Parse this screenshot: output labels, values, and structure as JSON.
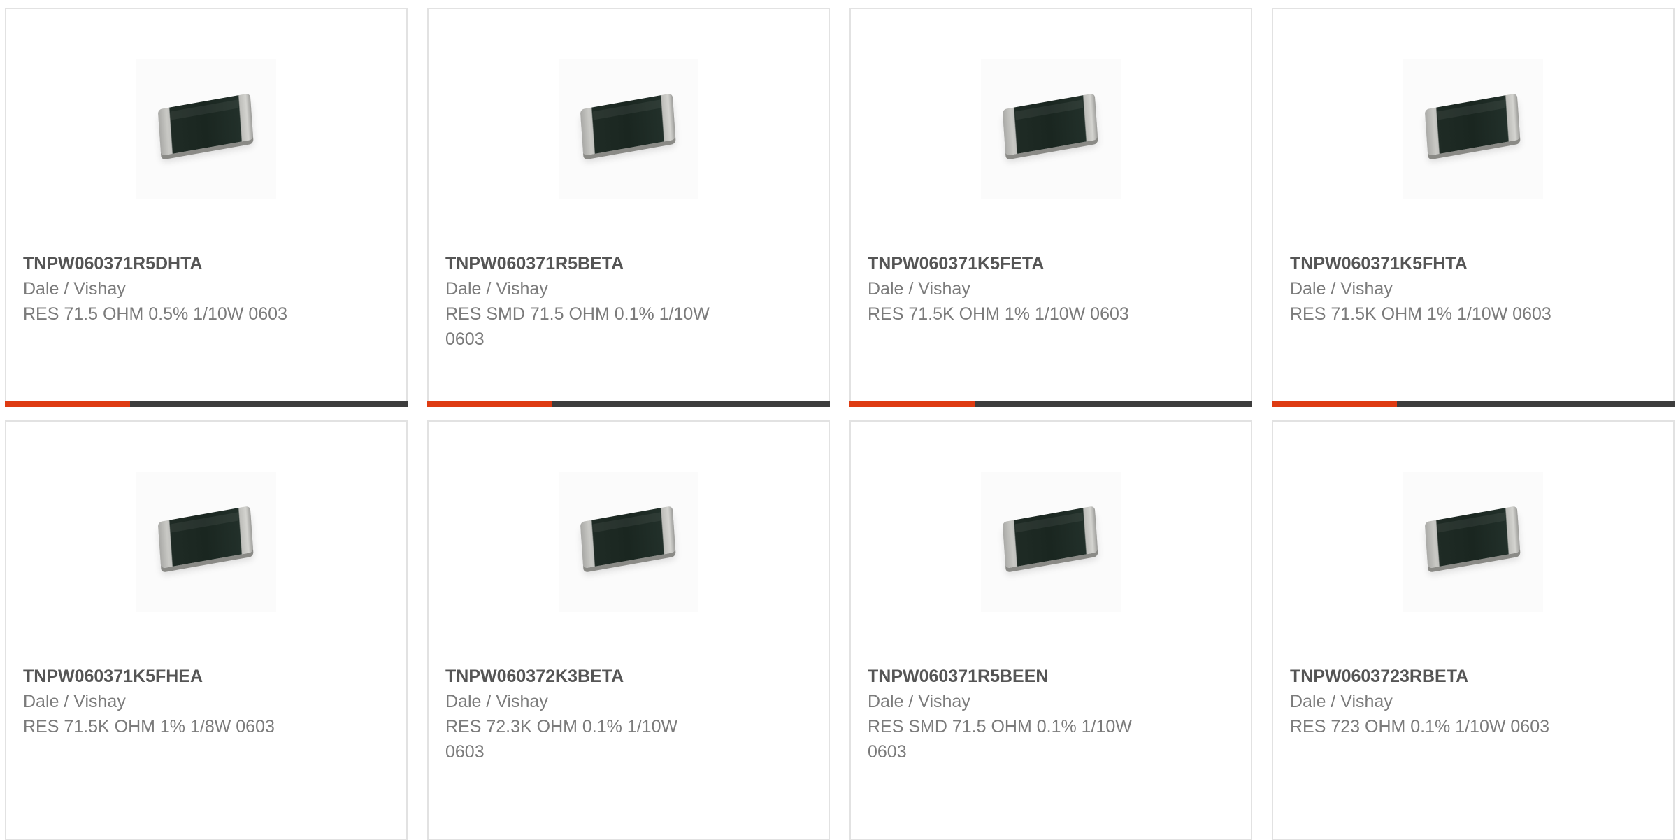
{
  "colors": {
    "accent": "#de3b12",
    "bar_track": "#3d3d3d",
    "part_number": "#555555",
    "secondary_text": "#7b7b7b"
  },
  "products": [
    {
      "part_number": "TNPW060371R5DHTA",
      "manufacturer": "Dale / Vishay",
      "description": "RES 71.5 OHM 0.5% 1/10W 0603",
      "image_icon": "smd-resistor-chip-icon",
      "progress": 0.31
    },
    {
      "part_number": "TNPW060371R5BETA",
      "manufacturer": "Dale / Vishay",
      "description": "RES SMD 71.5 OHM 0.1% 1/10W 0603",
      "image_icon": "smd-resistor-chip-icon",
      "progress": 0.31
    },
    {
      "part_number": "TNPW060371K5FETA",
      "manufacturer": "Dale / Vishay",
      "description": "RES 71.5K OHM 1% 1/10W 0603",
      "image_icon": "smd-resistor-chip-icon",
      "progress": 0.31
    },
    {
      "part_number": "TNPW060371K5FHTA",
      "manufacturer": "Dale / Vishay",
      "description": "RES 71.5K OHM 1% 1/10W 0603",
      "image_icon": "smd-resistor-chip-icon",
      "progress": 0.31
    },
    {
      "part_number": "TNPW060371K5FHEA",
      "manufacturer": "Dale / Vishay",
      "description": "RES 71.5K OHM 1% 1/8W 0603",
      "image_icon": "smd-resistor-chip-icon"
    },
    {
      "part_number": "TNPW060372K3BETA",
      "manufacturer": "Dale / Vishay",
      "description": "RES 72.3K OHM 0.1% 1/10W 0603",
      "image_icon": "smd-resistor-chip-icon"
    },
    {
      "part_number": "TNPW060371R5BEEN",
      "manufacturer": "Dale / Vishay",
      "description": "RES SMD 71.5 OHM 0.1% 1/10W 0603",
      "image_icon": "smd-resistor-chip-icon"
    },
    {
      "part_number": "TNPW0603723RBETA",
      "manufacturer": "Dale / Vishay",
      "description": "RES 723 OHM 0.1% 1/10W 0603",
      "image_icon": "smd-resistor-chip-icon"
    }
  ]
}
